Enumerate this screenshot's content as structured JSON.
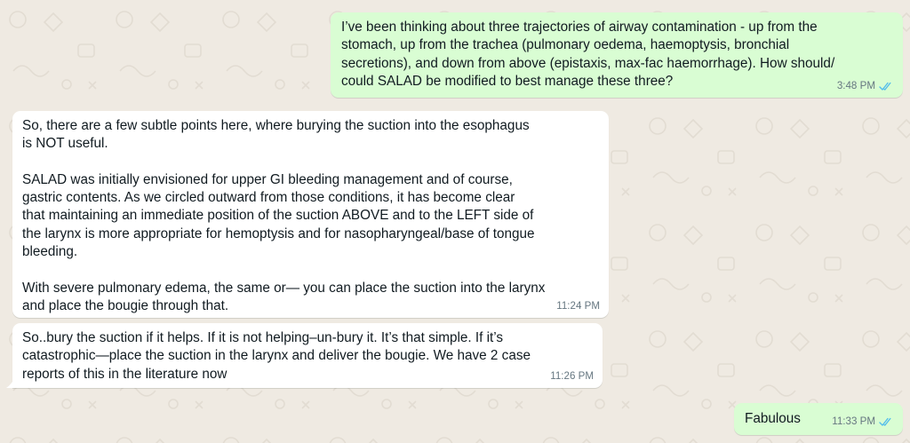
{
  "messages": [
    {
      "direction": "outgoing",
      "text": "I’ve been thinking about three trajectories of airway contamination - up from the\nstomach, up from the trachea (pulmonary oedema, haemoptysis, bronchial\nsecretions), and down from above (epistaxis, max-fac haemorrhage). How should/\ncould SALAD be modified to best manage these three?",
      "time": "3:48 PM",
      "status": "read",
      "status_icon": "double-check-icon"
    },
    {
      "direction": "incoming",
      "text": "So, there are a few subtle points here, where burying the suction into the esophagus\nis NOT useful.\n\nSALAD was initially envisioned for upper GI bleeding management and of course,\ngastric contents.  As we circled outward from those conditions, it has become clear\nthat maintaining an immediate position of the suction ABOVE and to the LEFT side of\nthe larynx is more appropriate for hemoptysis and for nasopharyngeal/base of tongue\nbleeding.\n\nWith severe pulmonary edema, the same or— you  can place the suction into the larynx\nand place the bougie through that.",
      "time": "11:24 PM"
    },
    {
      "direction": "incoming",
      "text": "So..bury the suction if it helps. If it is not helping–un-bury it. It’s that simple. If it’s\ncatastrophic—place the suction in the larynx and deliver the bougie.  We have 2 case\nreports of this in the literature now",
      "time": "11:26 PM"
    },
    {
      "direction": "outgoing",
      "text": "Fabulous",
      "time": "11:33 PM",
      "status": "read",
      "status_icon": "double-check-icon"
    }
  ],
  "colors": {
    "chat_background": "#efeae2",
    "outgoing_bubble": "#d9fdd3",
    "incoming_bubble": "#ffffff",
    "read_ticks": "#53bdeb",
    "timestamp": "#667781"
  }
}
